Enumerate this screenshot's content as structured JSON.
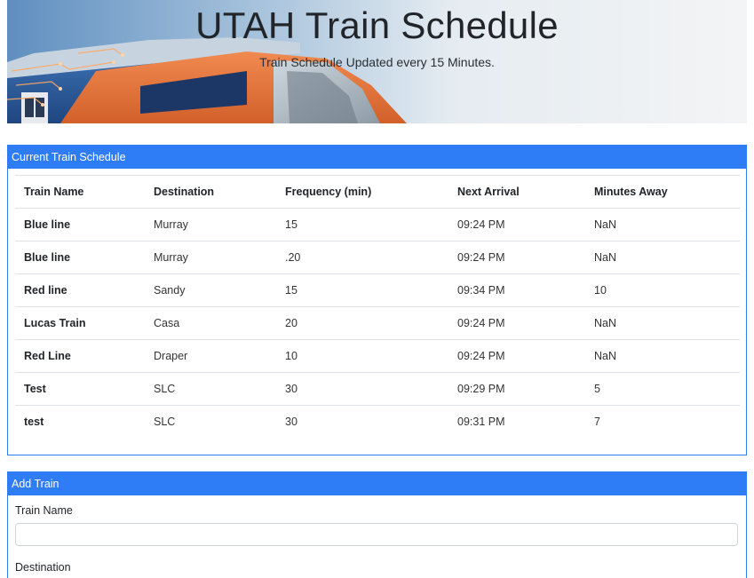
{
  "hero": {
    "title": "UTAH Train Schedule",
    "subtitle": "Train Schedule Updated every 15 Minutes."
  },
  "schedule": {
    "header": "Current Train Schedule",
    "columns": [
      "Train Name",
      "Destination",
      "Frequency (min)",
      "Next Arrival",
      "Minutes Away"
    ],
    "rows": [
      [
        "Blue line",
        "Murray",
        "15",
        "09:24 PM",
        "NaN"
      ],
      [
        "Blue line",
        "Murray",
        ".20",
        "09:24 PM",
        "NaN"
      ],
      [
        "Red line",
        "Sandy",
        "15",
        "09:34 PM",
        "10"
      ],
      [
        "Lucas Train",
        "Casa",
        "20",
        "09:24 PM",
        "NaN"
      ],
      [
        "Red Line",
        "Draper",
        "10",
        "09:24 PM",
        "NaN"
      ],
      [
        "Test",
        "SLC",
        "30",
        "09:29 PM",
        "5"
      ],
      [
        "test",
        "SLC",
        "30",
        "09:31 PM",
        "7"
      ]
    ]
  },
  "add_train": {
    "header": "Add Train",
    "train_name_label": "Train Name",
    "train_name_value": "",
    "destination_label": "Destination"
  },
  "colors": {
    "accent": "#2f7df6",
    "train_orange": "#e8743b",
    "train_blue": "#2a5a9a"
  }
}
